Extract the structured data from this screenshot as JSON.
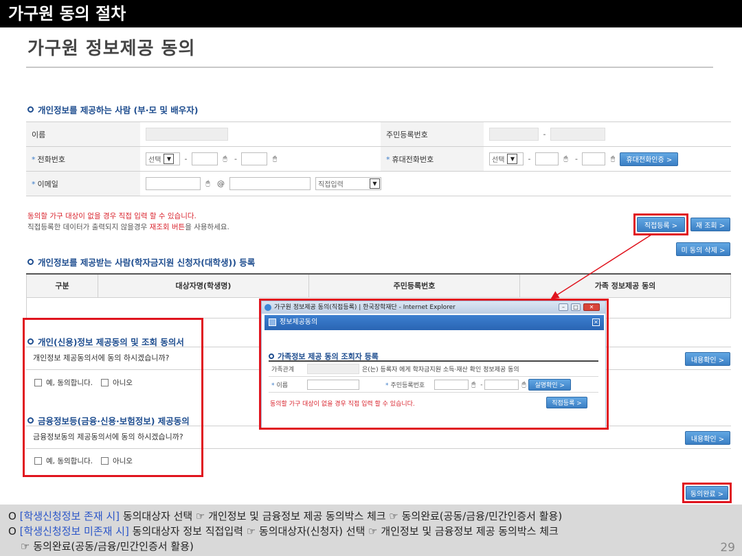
{
  "slide": {
    "header": "가구원 동의 절차",
    "title": "가구원 정보제공 동의",
    "page_number": "29"
  },
  "provider_section": {
    "title": "개인정보를 제공하는 사람 (부·모 및 배우자)",
    "labels": {
      "name": "이름",
      "resident_id": "주민등록번호",
      "phone": "전화번호",
      "mobile": "휴대전화번호",
      "email": "이메일"
    },
    "phone_select": "선택",
    "mobile_select": "선택",
    "email_domain_select": "직접입력",
    "at_sign": "@",
    "mobile_verify_button": "휴대전화인증 >",
    "note_red": "동의할 가구 대상이 없을 경우 직접 입력 할 수 있습니다.",
    "note_grey_prefix": "직접등록한 데이터가 출력되지 않을경우 ",
    "note_grey_highlight": "재조회 버튼",
    "note_grey_suffix": "을 사용하세요.",
    "direct_register_button": "직접등록 >",
    "re_query_button": "재 조회 >",
    "delete_unagreed_button": "미 동의 삭제 >"
  },
  "recipient_section": {
    "title": "개인정보를 제공받는 사람(학자금지원 신청자(대학생)) 등록",
    "columns": [
      "구분",
      "대상자명(학생명)",
      "주민등록번호",
      "가족 정보제공 동의"
    ]
  },
  "consent_personal": {
    "title": "개인(신용)정보 제공동의 및 조회 동의서",
    "question": "개인정보 제공동의서에 동의 하시겠습니까?",
    "yes": "예, 동의합니다.",
    "no": "아니오",
    "confirm_button": "내용확인 >"
  },
  "consent_financial": {
    "title": "금융정보등(금융·신용·보험정보) 제공동의",
    "question": "금융정보동의 제공동의서에 동의 하시겠습니까?",
    "yes": "예, 동의합니다.",
    "no": "아니오",
    "confirm_button": "내용확인 >"
  },
  "consent_complete_button": "동의완료 >",
  "popup": {
    "window_title": "가구원 정보제공 동의(직접등록) | 한국장학재단 - Internet Explorer",
    "panel_title": "정보제공동의",
    "section_title": "가족정보 제공 동의 조회자 등록",
    "relation_label": "가족관계",
    "relation_text": "은(는) 등록자 에게 학자금지원 소득·재산 확인 정보제공 동의",
    "name_label": "이름",
    "resident_label": "주민등록번호",
    "verify_button": "실명확인 >",
    "note": "동의할 가구 대상이 없을 경우 직접 입력 할 수 있습니다.",
    "register_button": "직접등록 >"
  },
  "footer": {
    "line1_highlight": "[학생신청정보 존재 시]",
    "line1_text": " 동의대상자 선택 ☞ 개인정보 및 금융정보 제공 동의박스 체크 ☞ 동의완료(공동/금융/민간인증서 활용)",
    "line2_highlight": "[학생신청정보 미존재 시]",
    "line2_text": " 동의대상자 정보 직접입력 ☞ 동의대상자(신청자) 선택 ☞ 개인정보 및 금융정보 제공 동의박스 체크",
    "line3_text": "☞ 동의완료(공동/금융/민간인증서 활용)",
    "bullet": "O"
  },
  "colors": {
    "accent_blue": "#1e4d8f",
    "highlight_red": "#e0141e",
    "button_blue": "#3b7fc4"
  }
}
